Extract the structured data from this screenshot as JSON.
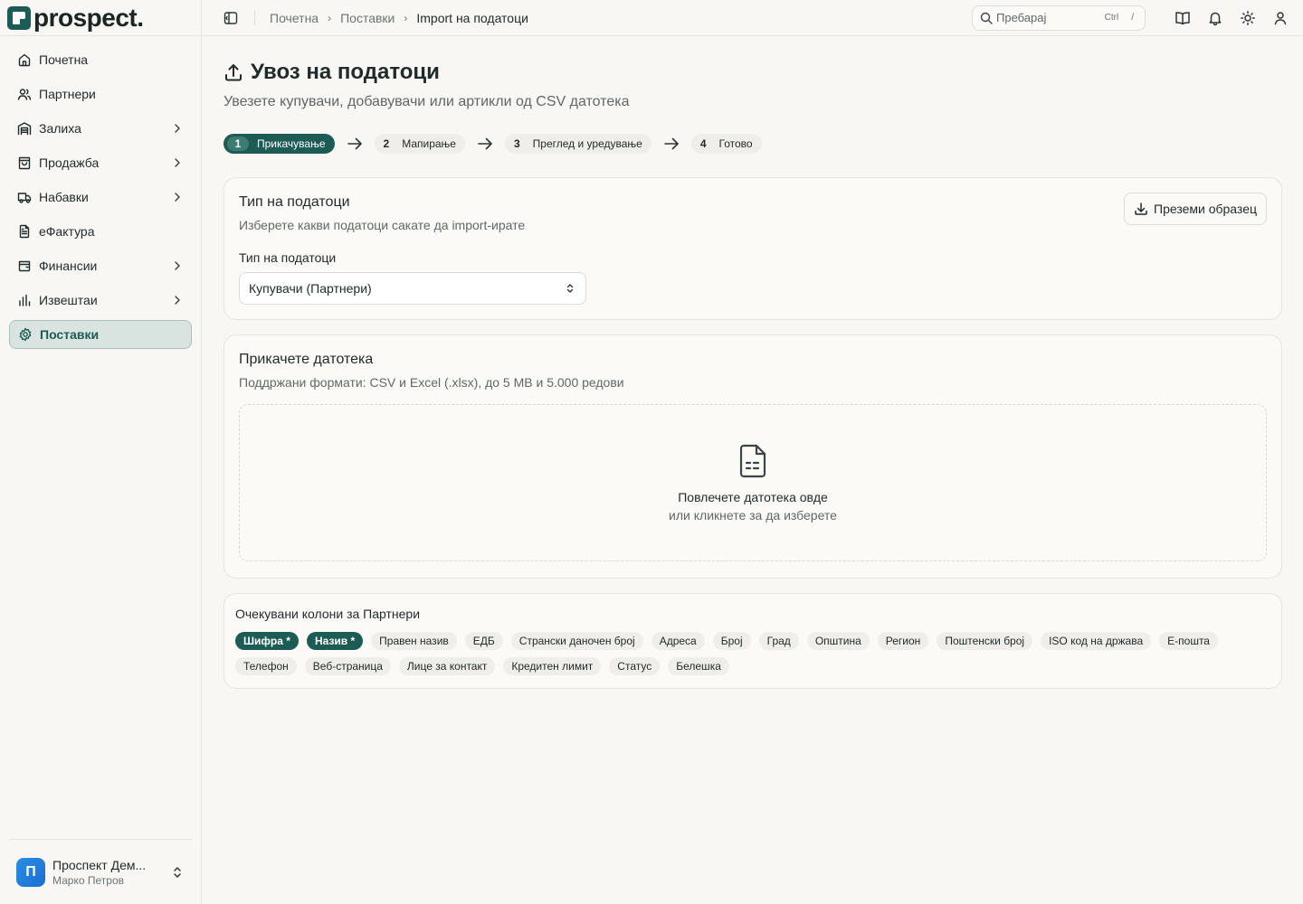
{
  "brand": {
    "name": "prospect.",
    "color": "#1d5c55"
  },
  "sidebar": {
    "items": [
      {
        "label": "Почетна",
        "icon": "home-icon",
        "chevron": false
      },
      {
        "label": "Партнери",
        "icon": "users-icon",
        "chevron": false
      },
      {
        "label": "Залиха",
        "icon": "warehouse-icon",
        "chevron": true
      },
      {
        "label": "Продажба",
        "icon": "shopping-bag-icon",
        "chevron": true
      },
      {
        "label": "Набавки",
        "icon": "truck-icon",
        "chevron": true
      },
      {
        "label": "еФактура",
        "icon": "document-icon",
        "chevron": false
      },
      {
        "label": "Финансии",
        "icon": "wallet-icon",
        "chevron": true
      },
      {
        "label": "Извештаи",
        "icon": "bar-chart-icon",
        "chevron": true
      },
      {
        "label": "Поставки",
        "icon": "gear-icon",
        "chevron": false,
        "active": true
      }
    ],
    "footer": {
      "avatar_letter": "П",
      "company": "Проспект Дем...",
      "user": "Марко Петров"
    }
  },
  "topbar": {
    "breadcrumbs": [
      "Почетна",
      "Поставки",
      "Import на податоци"
    ],
    "search": {
      "placeholder": "Пребарај",
      "kbd1": "Ctrl",
      "kbd2": "/"
    }
  },
  "page": {
    "title": "Увоз на податоци",
    "subtitle": "Увезете купувачи, добавувачи или артикли од CSV датотека",
    "steps": [
      {
        "num": "1",
        "label": "Прикачување",
        "active": true
      },
      {
        "num": "2",
        "label": "Мапирање"
      },
      {
        "num": "3",
        "label": "Преглед и уредување"
      },
      {
        "num": "4",
        "label": "Готово"
      }
    ]
  },
  "data_type_card": {
    "title": "Тип на податоци",
    "desc": "Изберете какви податоци сакате да import-ирате",
    "download_label": "Преземи образец",
    "field_label": "Тип на податоци",
    "select_value": "Купувачи (Партнери)"
  },
  "upload_card": {
    "title": "Прикачете датотека",
    "desc": "Поддржани формати: CSV и Excel (.xlsx), до 5 MB и 5.000 редови",
    "drop_main": "Повлечете датотека овде",
    "drop_sub": "или кликнете за да изберете"
  },
  "columns_card": {
    "title": "Очекувани колони за Партнери",
    "chips": [
      {
        "label": "Шифра *",
        "required": true
      },
      {
        "label": "Назив *",
        "required": true
      },
      {
        "label": "Правен назив"
      },
      {
        "label": "ЕДБ"
      },
      {
        "label": "Странски даночен број"
      },
      {
        "label": "Адреса"
      },
      {
        "label": "Број"
      },
      {
        "label": "Град"
      },
      {
        "label": "Општина"
      },
      {
        "label": "Регион"
      },
      {
        "label": "Поштенски број"
      },
      {
        "label": "ISO код на држава"
      },
      {
        "label": "Е-пошта"
      },
      {
        "label": "Телефон"
      },
      {
        "label": "Веб-страница"
      },
      {
        "label": "Лице за контакт"
      },
      {
        "label": "Кредитен лимит"
      },
      {
        "label": "Статус"
      },
      {
        "label": "Белешка"
      }
    ]
  }
}
